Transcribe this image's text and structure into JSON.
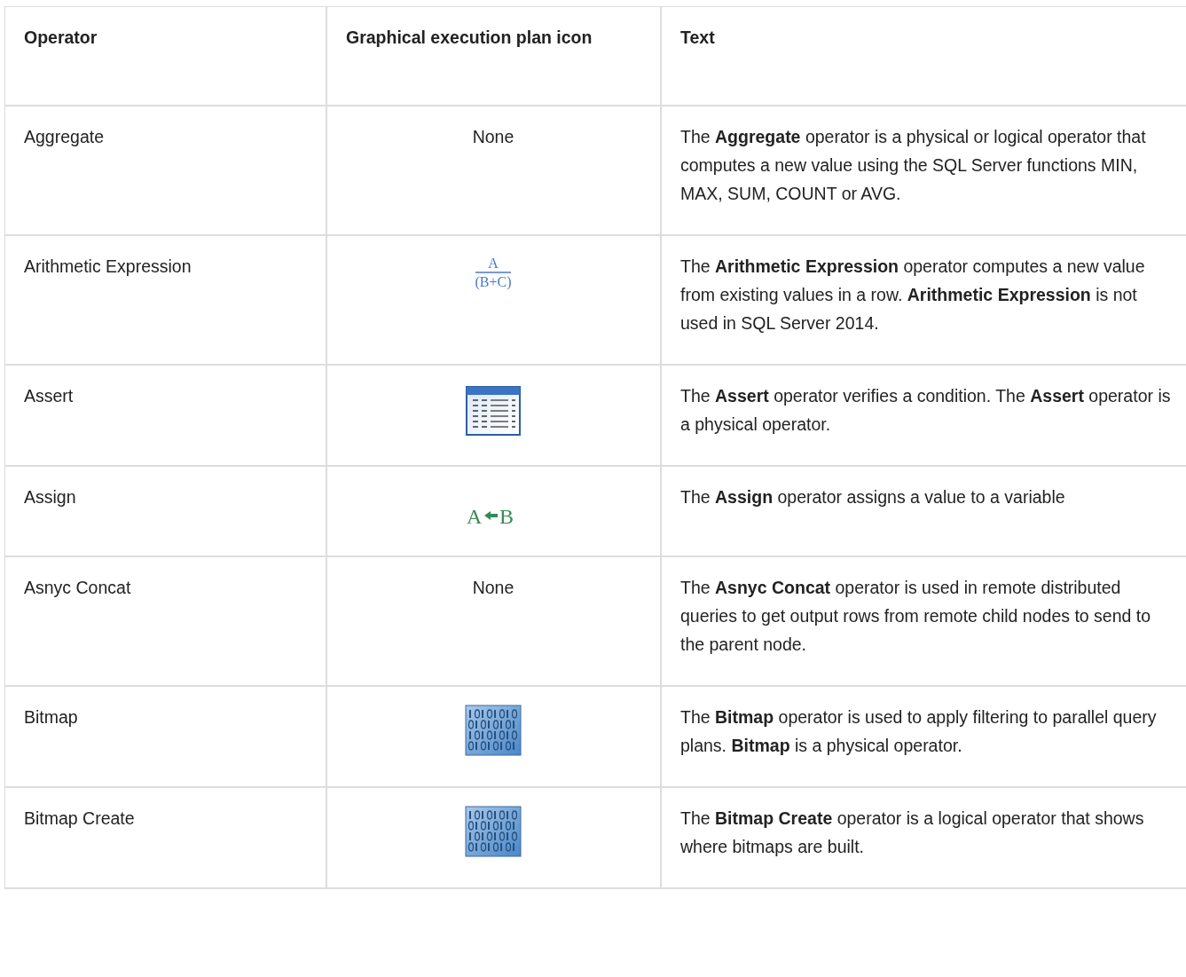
{
  "table": {
    "columns": [
      "Operator",
      "Graphical execution plan icon",
      "Text"
    ],
    "rows": [
      {
        "operator": "Aggregate",
        "icon": {
          "kind": "none",
          "label": "None"
        },
        "text": "The **Aggregate** operator is a physical or logical operator that computes a new value using the SQL Server functions MIN, MAX, SUM, COUNT or AVG."
      },
      {
        "operator": "Arithmetic Expression",
        "icon": {
          "kind": "fraction",
          "numerator": "A",
          "denominator": "(B+C)"
        },
        "text": "The **Arithmetic Expression** operator computes a new value from existing values in a row. **Arithmetic Expression** is not used in SQL Server 2014."
      },
      {
        "operator": "Assert",
        "icon": {
          "kind": "table"
        },
        "text": "The **Assert** operator verifies a condition.  The **Assert** operator is a physical operator."
      },
      {
        "operator": "Assign",
        "icon": {
          "kind": "assign",
          "left": "A",
          "right": "B"
        },
        "text": "The **Assign** operator assigns a value to a variable"
      },
      {
        "operator": "Asnyc Concat",
        "icon": {
          "kind": "none",
          "label": "None"
        },
        "text": "The  **Asnyc Concat** operator is used in remote distributed queries to get output rows from remote child nodes to send to the parent node."
      },
      {
        "operator": "Bitmap",
        "icon": {
          "kind": "bitmap"
        },
        "text": "The **Bitmap** operator is used to apply filtering to parallel query plans.  **Bitmap** is a physical operator."
      },
      {
        "operator": "Bitmap Create",
        "icon": {
          "kind": "bitmap"
        },
        "text": "The **Bitmap Create** operator is a logical operator that shows where bitmaps are built."
      }
    ]
  }
}
